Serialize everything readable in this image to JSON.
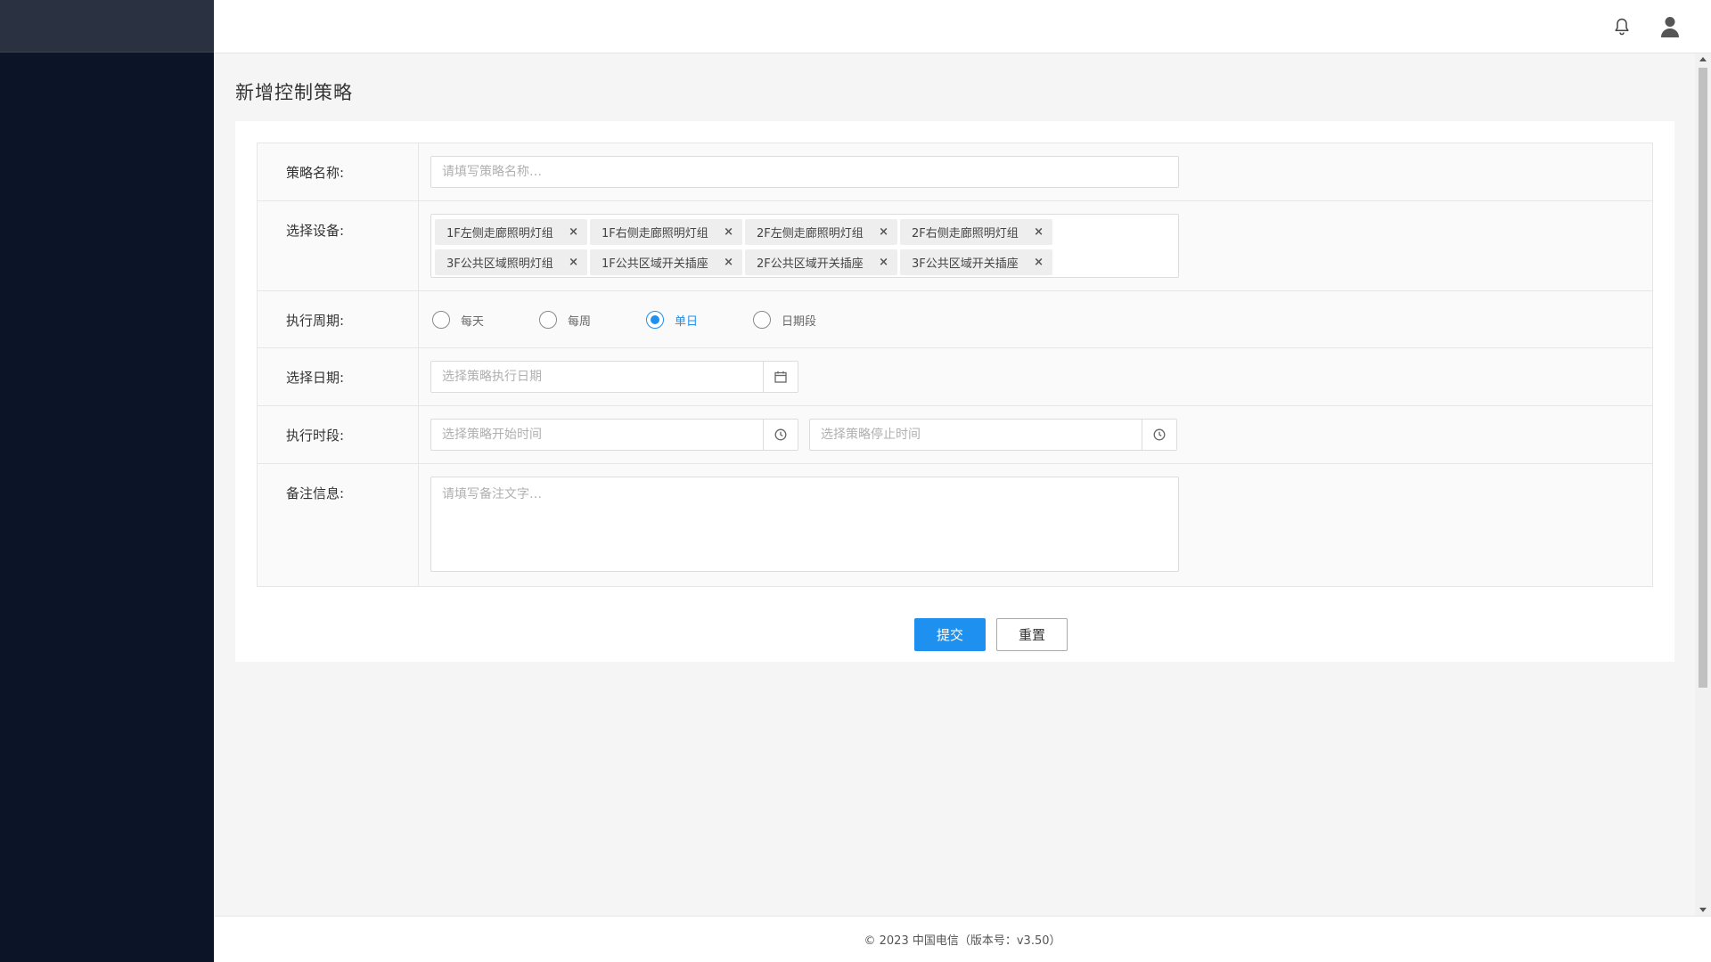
{
  "header": {
    "bell_icon": "bell-icon",
    "user_icon": "user-icon"
  },
  "page": {
    "title": "新增控制策略"
  },
  "form": {
    "name": {
      "label": "策略名称:",
      "placeholder": "请填写策略名称…",
      "value": ""
    },
    "devices": {
      "label": "选择设备:",
      "tags": [
        "1F左侧走廊照明灯组",
        "1F右侧走廊照明灯组",
        "2F左侧走廊照明灯组",
        "2F右侧走廊照明灯组",
        "3F公共区域照明灯组",
        "1F公共区域开关插座",
        "2F公共区域开关插座",
        "3F公共区域开关插座"
      ],
      "remove_glyph": "×"
    },
    "cycle": {
      "label": "执行周期:",
      "options": [
        "每天",
        "每周",
        "单日",
        "日期段"
      ],
      "selected": "单日"
    },
    "date": {
      "label": "选择日期:",
      "placeholder": "选择策略执行日期",
      "icon": "calendar-icon"
    },
    "time": {
      "label": "执行时段:",
      "start_placeholder": "选择策略开始时间",
      "end_placeholder": "选择策略停止时间",
      "icon": "clock-icon"
    },
    "note": {
      "label": "备注信息:",
      "placeholder": "请填写备注文字…"
    },
    "submit_label": "提交",
    "reset_label": "重置"
  },
  "footer": {
    "text": "© 2023 中国电信（版本号：v3.50）"
  },
  "colors": {
    "sidebar": "#0c1427",
    "primary": "#1e90f0"
  }
}
